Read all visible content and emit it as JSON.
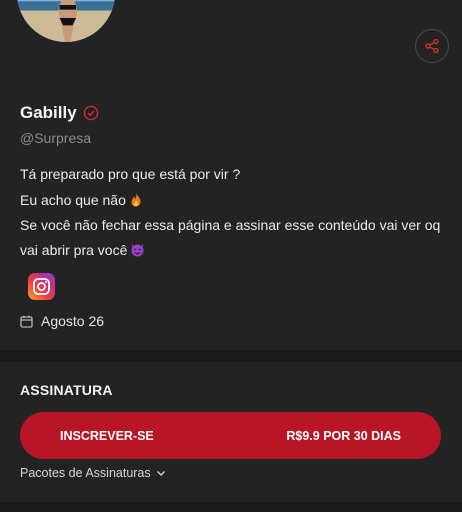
{
  "profile": {
    "name": "Gabilly",
    "handle": "@Surpresa",
    "bio": [
      {
        "text": "Tá preparado pro que está por vir ?",
        "emoji": ""
      },
      {
        "text": "Eu acho que não",
        "emoji": "fire"
      },
      {
        "text": "Se você não fechar essa página e assinar esse conteúdo vai ver oq vai abrir pra você",
        "emoji": "devil"
      }
    ],
    "date": "Agosto 26"
  },
  "subscription": {
    "title": "ASSINATURA",
    "button_label": "INSCREVER-SE",
    "price_label": "R$9.9 POR 30 DIAS",
    "packages_label": "Pacotes de Assinaturas"
  },
  "colors": {
    "background": "#232323",
    "accent": "#b81626",
    "verified": "#d42b3a"
  },
  "icons": {
    "share": "share-icon",
    "verified": "verified-badge-icon",
    "instagram": "instagram-icon",
    "calendar": "calendar-icon",
    "chevron": "chevron-down-icon"
  }
}
